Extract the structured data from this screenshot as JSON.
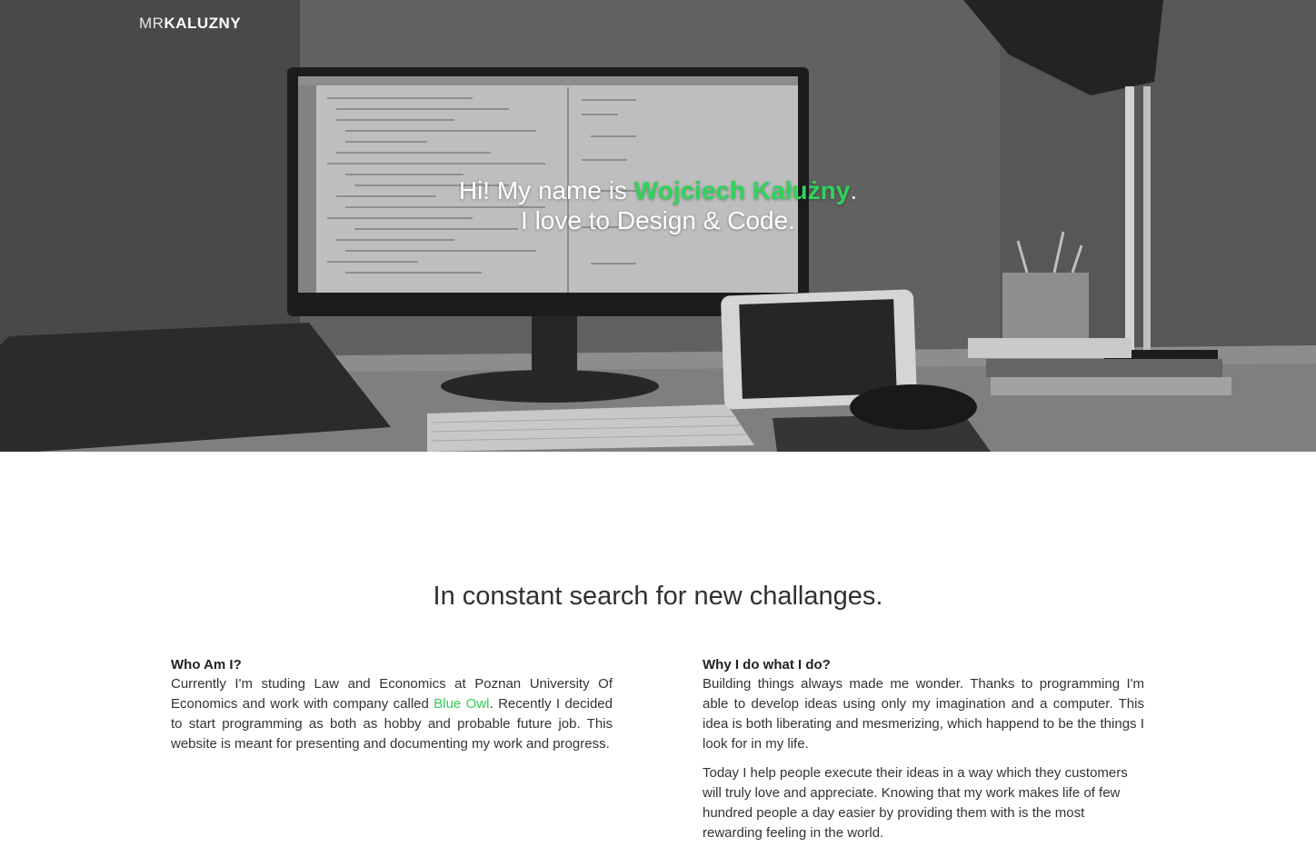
{
  "header": {
    "brand_prefix": "MR",
    "brand_name": "KALUZNY"
  },
  "hero": {
    "line1_prefix": "Hi! My name is ",
    "line1_name": "Wojciech Kałużny",
    "line1_suffix": ".",
    "line2": "I love to Design & Code.",
    "accent_color": "#2fd35a"
  },
  "about": {
    "title": "In constant search for new challanges.",
    "left": {
      "heading": "Who Am I?",
      "text_before_link": "Currently I'm studing Law and Economics at Poznan University Of Economics and work with company called ",
      "link_text": "Blue Owl",
      "text_after_link": ". Recently I decided to start programming as both as hobby and probable future job. This website is meant for presenting and documenting my work and progress."
    },
    "right": {
      "heading": "Why I do what I do?",
      "paragraph1": "Building things always made me wonder. Thanks to programming I'm able to develop ideas using only my imagination and a computer. This idea is both liberating and mesmerizing, which happend to be the things I look for in my life.",
      "paragraph2": "Today I help people execute their ideas in a way which they customers will truly love and appreciate. Knowing that my work makes life of few hundred people a day easier by providing them with is the most rewarding feeling in the world."
    }
  }
}
